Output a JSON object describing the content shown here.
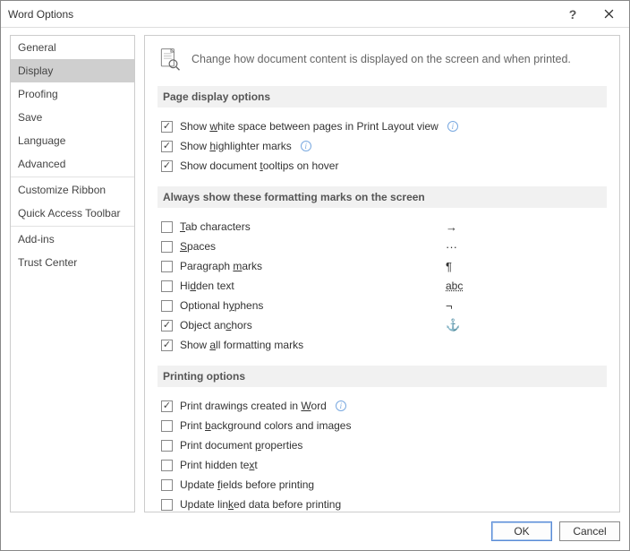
{
  "window": {
    "title": "Word Options"
  },
  "sidebar": {
    "items": [
      {
        "label": "General"
      },
      {
        "label": "Display",
        "selected": true
      },
      {
        "label": "Proofing"
      },
      {
        "label": "Save"
      },
      {
        "label": "Language"
      },
      {
        "label": "Advanced"
      },
      {
        "sep": true
      },
      {
        "label": "Customize Ribbon"
      },
      {
        "label": "Quick Access Toolbar"
      },
      {
        "sep": true
      },
      {
        "label": "Add-ins"
      },
      {
        "label": "Trust Center"
      }
    ]
  },
  "intro": "Change how document content is displayed on the screen and when printed.",
  "sections": {
    "pageDisplay": {
      "title": "Page display options",
      "opts": [
        {
          "checked": true,
          "pre": "Show ",
          "u": "w",
          "post": "hite space between pages in Print Layout view",
          "info": true
        },
        {
          "checked": true,
          "pre": "Show ",
          "u": "h",
          "post": "ighlighter marks",
          "info": true
        },
        {
          "checked": true,
          "pre": "Show document ",
          "u": "t",
          "post": "ooltips on hover"
        }
      ]
    },
    "formatting": {
      "title": "Always show these formatting marks on the screen",
      "opts": [
        {
          "checked": false,
          "u": "T",
          "post": "ab characters",
          "sym": "→"
        },
        {
          "checked": false,
          "u": "S",
          "post": "paces",
          "sym": "···"
        },
        {
          "checked": false,
          "pre": "Paragraph ",
          "u": "m",
          "post": "arks",
          "sym": "¶"
        },
        {
          "checked": false,
          "pre": "Hi",
          "u": "d",
          "post": "den text",
          "sym": "abc",
          "symClass": "hidden-abc"
        },
        {
          "checked": false,
          "pre": "Optional h",
          "u": "y",
          "post": "phens",
          "sym": "¬"
        },
        {
          "checked": true,
          "pre": "Object an",
          "u": "c",
          "post": "hors",
          "sym": "⚓"
        },
        {
          "checked": true,
          "pre": "Show ",
          "u": "a",
          "post": "ll formatting marks"
        }
      ]
    },
    "printing": {
      "title": "Printing options",
      "opts": [
        {
          "checked": true,
          "pre": "Print drawings created in ",
          "u": "W",
          "post": "ord",
          "info": true
        },
        {
          "checked": false,
          "pre": "Print ",
          "u": "b",
          "post": "ackground colors and images"
        },
        {
          "checked": false,
          "pre": "Print document ",
          "u": "p",
          "post": "roperties"
        },
        {
          "checked": false,
          "pre": "Print hidden te",
          "u": "x",
          "post": "t"
        },
        {
          "checked": false,
          "pre": "Update ",
          "u": "f",
          "post": "ields before printing"
        },
        {
          "checked": false,
          "pre": "Update lin",
          "u": "k",
          "post": "ed data before printing"
        }
      ]
    }
  },
  "buttons": {
    "ok": "OK",
    "cancel": "Cancel"
  }
}
